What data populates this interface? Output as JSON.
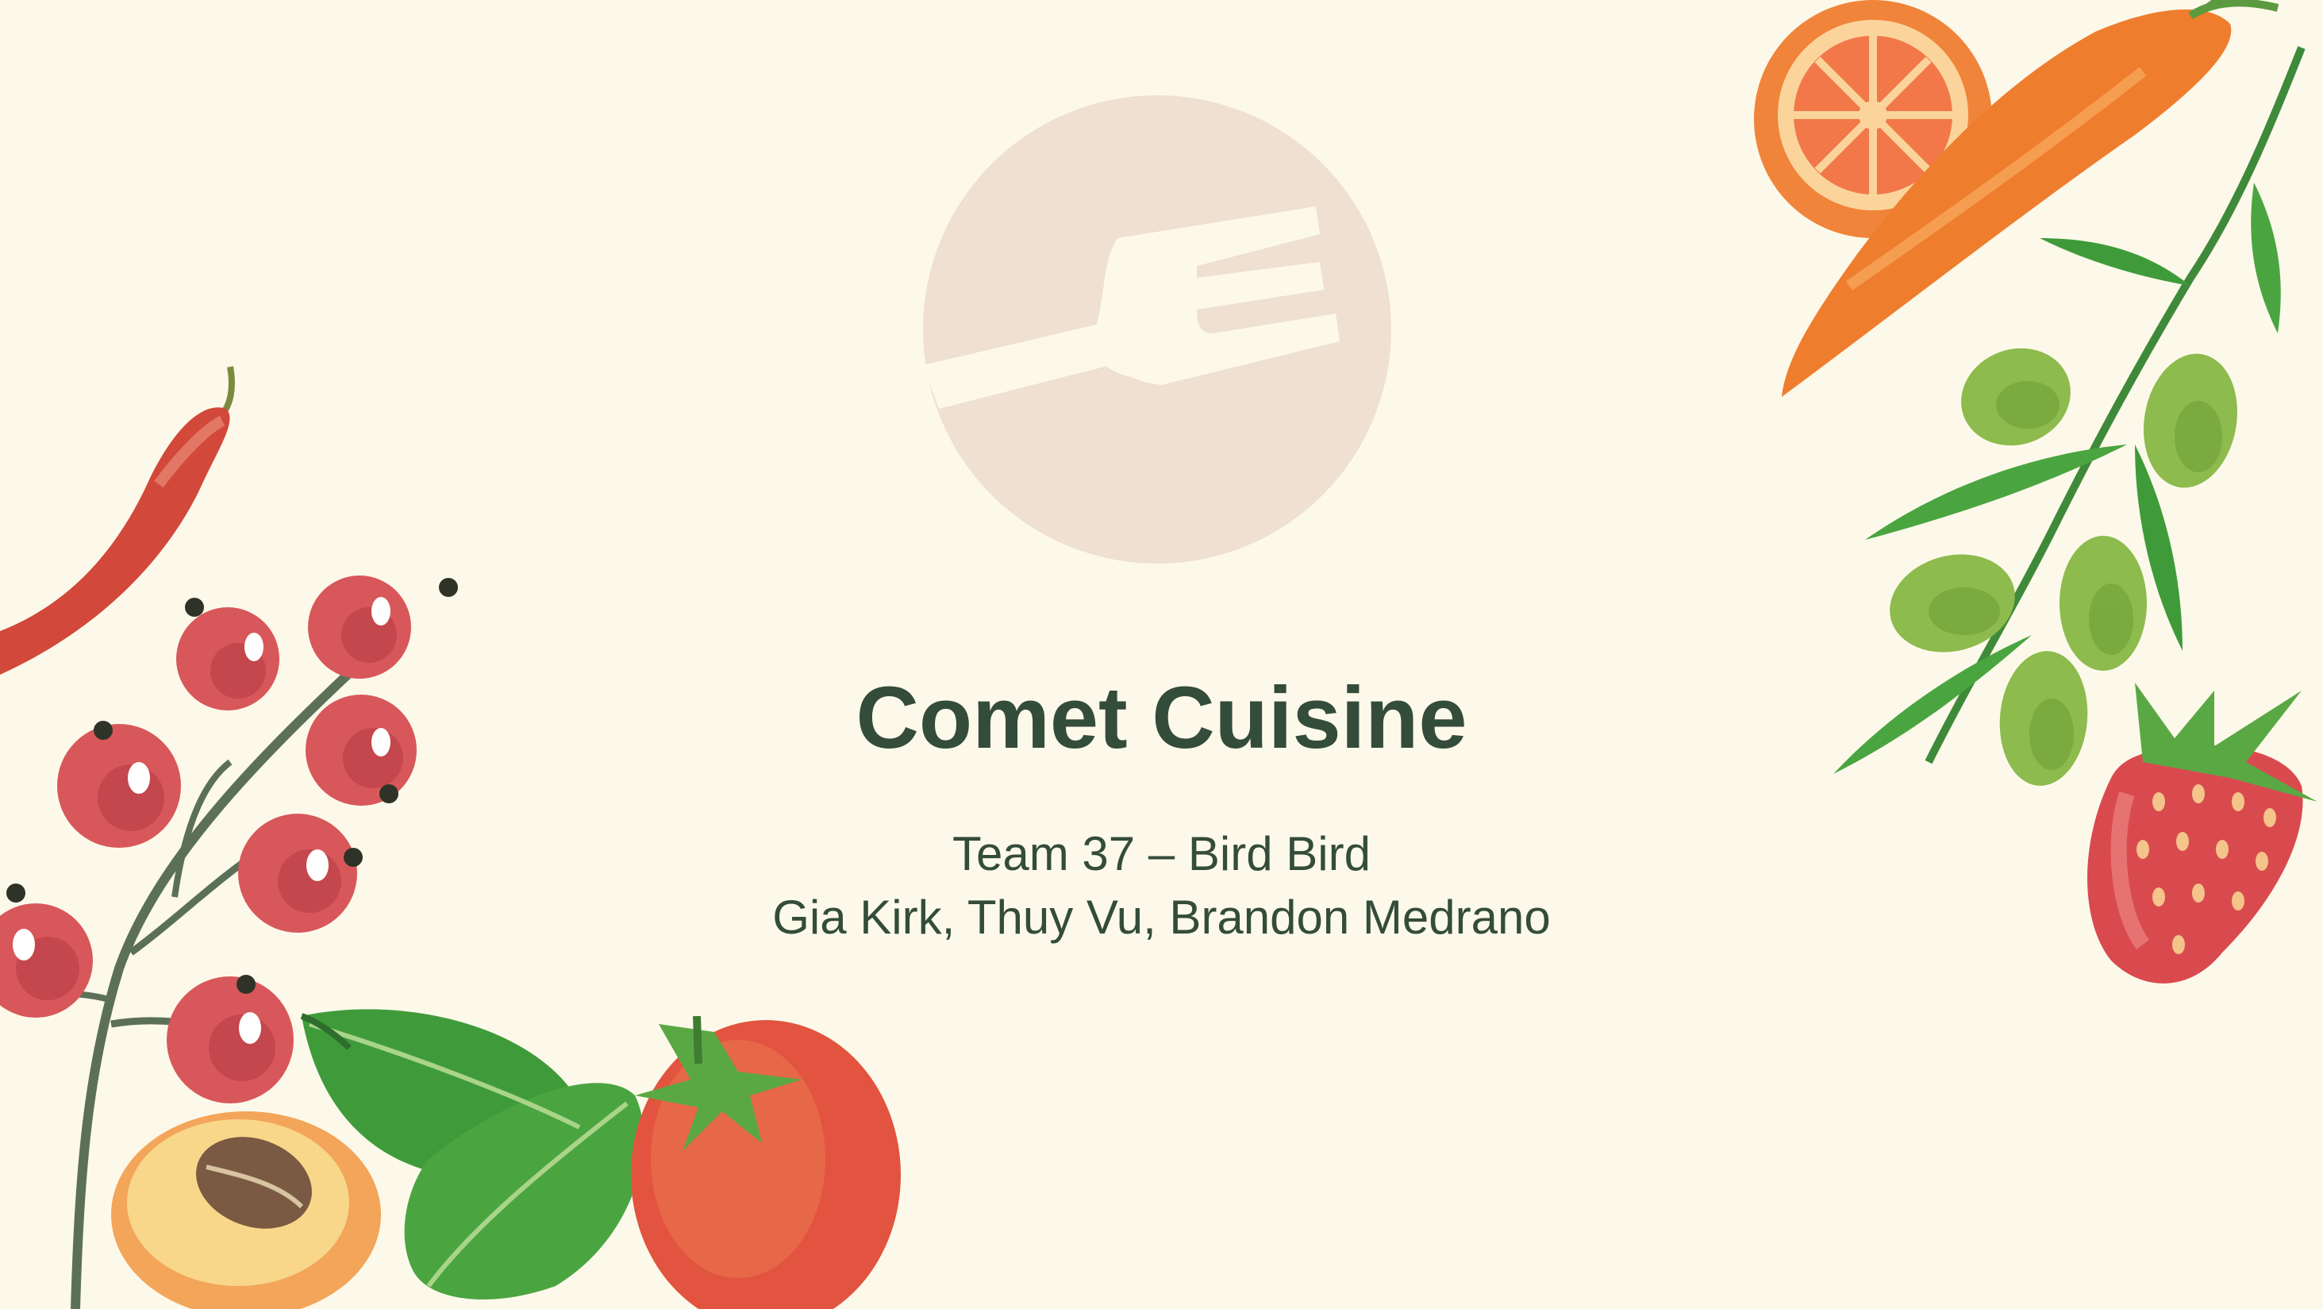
{
  "brand": {
    "name": "Comet Cuisine",
    "logo_icon": "fork-in-circle-icon",
    "logo_color": "#efe0d2",
    "text_color": "#344c3a",
    "background": "#fdf9ea"
  },
  "subtitle": {
    "team": "Team 37 – Bird Bird",
    "members": "Gia Kirk, Thuy Vu, Brandon Medrano"
  },
  "decorations": [
    "chili-pepper",
    "red-currants",
    "apricot",
    "basil-leaves",
    "tomato",
    "orange-slice",
    "carrot",
    "olive-branch",
    "strawberry"
  ]
}
